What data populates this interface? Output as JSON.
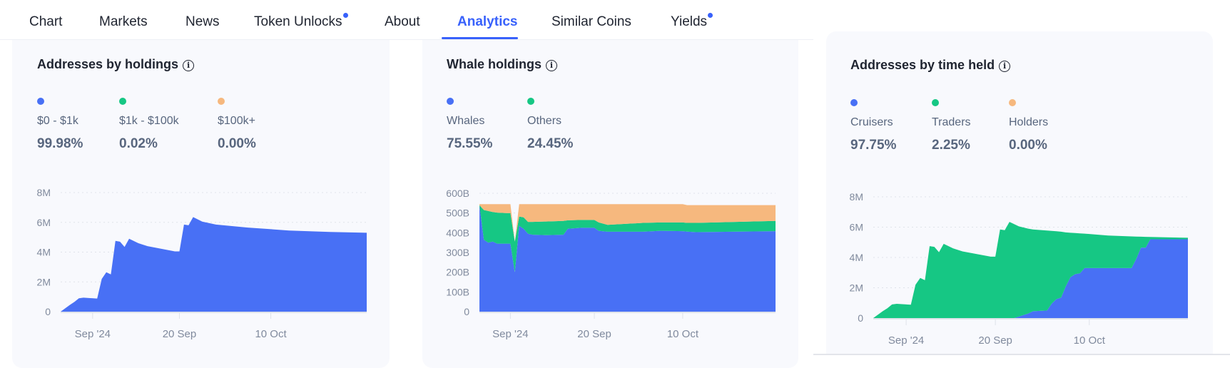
{
  "tabs": [
    {
      "label": "Chart",
      "active": false,
      "badge": false
    },
    {
      "label": "Markets",
      "active": false,
      "badge": false
    },
    {
      "label": "News",
      "active": false,
      "badge": false
    },
    {
      "label": "Token Unlocks",
      "active": false,
      "badge": true
    },
    {
      "label": "About",
      "active": false,
      "badge": false
    },
    {
      "label": "Analytics",
      "active": true,
      "badge": false
    },
    {
      "label": "Similar Coins",
      "active": false,
      "badge": false
    },
    {
      "label": "Yields",
      "active": false,
      "badge": true
    }
  ],
  "colors": {
    "blue": "#4870f5",
    "green": "#16c784",
    "orange": "#f6b87e",
    "accent": "#3861fb"
  },
  "panels": [
    {
      "title": "Addresses by holdings",
      "info_icon": "info-circle-icon",
      "legend": [
        {
          "label": "$0 - $1k",
          "value": "99.98%",
          "color": "#4870f5"
        },
        {
          "label": "$1k - $100k",
          "value": "0.02%",
          "color": "#16c784"
        },
        {
          "label": "$100k+",
          "value": "0.00%",
          "color": "#f6b87e"
        }
      ]
    },
    {
      "title": "Whale holdings",
      "info_icon": "info-circle-icon",
      "legend": [
        {
          "label": "Whales",
          "value": "75.55%",
          "color": "#4870f5"
        },
        {
          "label": "Others",
          "value": "24.45%",
          "color": "#16c784"
        }
      ]
    },
    {
      "title": "Addresses by time held",
      "info_icon": "info-circle-icon",
      "legend": [
        {
          "label": "Cruisers",
          "value": "97.75%",
          "color": "#4870f5"
        },
        {
          "label": "Traders",
          "value": "2.25%",
          "color": "#16c784"
        },
        {
          "label": "Holders",
          "value": "0.00%",
          "color": "#f6b87e"
        }
      ]
    }
  ],
  "chart_data": [
    {
      "type": "area",
      "stacked": true,
      "grid": true,
      "xlim": [
        "2024-08-25",
        "2024-10-31"
      ],
      "ylim": [
        0,
        8000000
      ],
      "yticks": [
        {
          "v": 0,
          "label": "0"
        },
        {
          "v": 2000000,
          "label": "2M"
        },
        {
          "v": 4000000,
          "label": "4M"
        },
        {
          "v": 6000000,
          "label": "6M"
        },
        {
          "v": 8000000,
          "label": "8M"
        }
      ],
      "xticks": [
        {
          "v": "2024-09-01",
          "label": "Sep '24"
        },
        {
          "v": "2024-09-20",
          "label": "20 Sep"
        },
        {
          "v": "2024-10-10",
          "label": "10 Oct"
        }
      ],
      "x": [
        "2024-08-25",
        "2024-08-27",
        "2024-08-28",
        "2024-08-29",
        "2024-08-30",
        "2024-09-02",
        "2024-09-03",
        "2024-09-04",
        "2024-09-05",
        "2024-09-06",
        "2024-09-07",
        "2024-09-08",
        "2024-09-09",
        "2024-09-11",
        "2024-09-13",
        "2024-09-19",
        "2024-09-20",
        "2024-09-21",
        "2024-09-22",
        "2024-09-23",
        "2024-09-25",
        "2024-09-28",
        "2024-10-05",
        "2024-10-14",
        "2024-10-23",
        "2024-10-31"
      ],
      "series": [
        {
          "name": "$0 - $1k",
          "color": "#4870f5",
          "values": [
            0,
            450000,
            650000,
            900000,
            940000,
            880000,
            2200000,
            2650000,
            2500000,
            4750000,
            4700000,
            4350000,
            4900000,
            4600000,
            4400000,
            4050000,
            4050000,
            5850000,
            5800000,
            6350000,
            6050000,
            5850000,
            5650000,
            5450000,
            5350000,
            5300000
          ]
        }
      ]
    },
    {
      "type": "area",
      "stacked": true,
      "grid": true,
      "xlim": [
        "2024-08-25",
        "2024-10-31"
      ],
      "ylim": [
        0,
        600
      ],
      "unit": "B",
      "yticks": [
        {
          "v": 0,
          "label": "0"
        },
        {
          "v": 100,
          "label": "100B"
        },
        {
          "v": 200,
          "label": "200B"
        },
        {
          "v": 300,
          "label": "300B"
        },
        {
          "v": 400,
          "label": "400B"
        },
        {
          "v": 500,
          "label": "500B"
        },
        {
          "v": 600,
          "label": "600B"
        }
      ],
      "xticks": [
        {
          "v": "2024-09-01",
          "label": "Sep '24"
        },
        {
          "v": "2024-09-20",
          "label": "20 Sep"
        },
        {
          "v": "2024-10-10",
          "label": "10 Oct"
        }
      ],
      "x": [
        "2024-08-25",
        "2024-08-26",
        "2024-08-27",
        "2024-08-28",
        "2024-08-29",
        "2024-08-31",
        "2024-09-01",
        "2024-09-02",
        "2024-09-03",
        "2024-09-04",
        "2024-09-05",
        "2024-09-06",
        "2024-09-09",
        "2024-09-13",
        "2024-09-14",
        "2024-09-17",
        "2024-09-20",
        "2024-09-21",
        "2024-09-23",
        "2024-10-01",
        "2024-10-05",
        "2024-10-10",
        "2024-10-11",
        "2024-10-13",
        "2024-10-31"
      ],
      "series": [
        {
          "name": "Whales",
          "color": "#4870f5",
          "values": [
            540,
            364,
            350,
            355,
            345,
            345,
            345,
            200,
            435,
            420,
            395,
            390,
            388,
            390,
            420,
            425,
            425,
            410,
            405,
            405,
            410,
            408,
            406,
            403,
            408
          ]
        },
        {
          "name": "Others",
          "color": "#16c784",
          "values": [
            0,
            151,
            160,
            150,
            157,
            155,
            155,
            155,
            47,
            58,
            60,
            65,
            69,
            70,
            43,
            40,
            40,
            42,
            35,
            45,
            42,
            44,
            44,
            47,
            52
          ]
        },
        {
          "color": "#f6b87e",
          "values": [
            5,
            30,
            35,
            40,
            43,
            45,
            45,
            0,
            63,
            67,
            90,
            90,
            88,
            85,
            82,
            80,
            80,
            93,
            105,
            95,
            93,
            93,
            90,
            90,
            80
          ]
        }
      ]
    },
    {
      "type": "area",
      "stacked": true,
      "grid": true,
      "xlim": [
        "2024-08-25",
        "2024-10-31"
      ],
      "ylim": [
        0,
        8000000
      ],
      "yticks": [
        {
          "v": 0,
          "label": "0"
        },
        {
          "v": 2000000,
          "label": "2M"
        },
        {
          "v": 4000000,
          "label": "4M"
        },
        {
          "v": 6000000,
          "label": "6M"
        },
        {
          "v": 8000000,
          "label": "8M"
        }
      ],
      "xticks": [
        {
          "v": "2024-09-01",
          "label": "Sep '24"
        },
        {
          "v": "2024-09-20",
          "label": "20 Sep"
        },
        {
          "v": "2024-10-10",
          "label": "10 Oct"
        }
      ],
      "x": [
        "2024-08-25",
        "2024-08-27",
        "2024-08-28",
        "2024-08-29",
        "2024-08-30",
        "2024-09-02",
        "2024-09-03",
        "2024-09-04",
        "2024-09-05",
        "2024-09-06",
        "2024-09-07",
        "2024-09-08",
        "2024-09-09",
        "2024-09-11",
        "2024-09-13",
        "2024-09-19",
        "2024-09-20",
        "2024-09-21",
        "2024-09-22",
        "2024-09-23",
        "2024-09-24",
        "2024-09-25",
        "2024-09-27",
        "2024-09-28",
        "2024-10-01",
        "2024-10-02",
        "2024-10-03",
        "2024-10-04",
        "2024-10-05",
        "2024-10-06",
        "2024-10-07",
        "2024-10-08",
        "2024-10-09",
        "2024-10-14",
        "2024-10-19",
        "2024-10-20",
        "2024-10-21",
        "2024-10-22",
        "2024-10-23",
        "2024-10-31"
      ],
      "series": [
        {
          "name": "Cruisers",
          "color": "#4870f5",
          "values": [
            0,
            0,
            0,
            0,
            0,
            0,
            0,
            0,
            0,
            0,
            0,
            0,
            0,
            0,
            0,
            0,
            0,
            0,
            0,
            0,
            0,
            100000,
            300000,
            450000,
            500000,
            950000,
            1250000,
            1350000,
            2100000,
            2700000,
            2900000,
            2950000,
            3300000,
            3300000,
            3300000,
            3900000,
            4650000,
            4650000,
            5200000,
            5200000
          ]
        },
        {
          "name": "Traders",
          "color": "#16c784",
          "values": [
            0,
            450000,
            650000,
            900000,
            940000,
            880000,
            2200000,
            2650000,
            2500000,
            4750000,
            4700000,
            4350000,
            4900000,
            4600000,
            4400000,
            4050000,
            4050000,
            5850000,
            5800000,
            6350000,
            6200000,
            5950000,
            5600000,
            5400000,
            5280000,
            4800000,
            4480000,
            4350000,
            3550000,
            2930000,
            2710000,
            2640000,
            2270000,
            2150000,
            2090000,
            1480000,
            720000,
            710000,
            150000,
            100000
          ]
        }
      ]
    }
  ]
}
